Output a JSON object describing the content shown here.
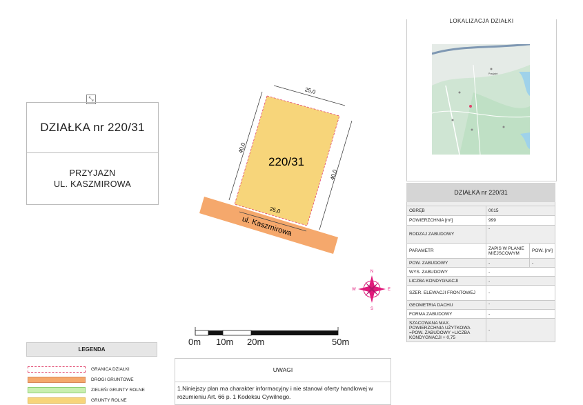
{
  "title": {
    "plot_name": "DZIAŁKA nr 220/31",
    "location_line1": "PRZYJAZN",
    "location_line2": "UL. KASZMIROWA"
  },
  "plan": {
    "plot_label": "220/31",
    "dim_top": "25,0",
    "dim_bottom": "25,0",
    "dim_left": "40,0",
    "dim_right": "40,0",
    "street": "ul. Kaszmirowa",
    "colors": {
      "plot_fill": "#f7d57a",
      "road_fill": "#f5a86c",
      "boundary": "#e0436b"
    }
  },
  "compass": {
    "n": "N",
    "s": "S",
    "e": "E",
    "w": "W",
    "color": "#e0197a"
  },
  "scale": {
    "labels": [
      "0m",
      "10m",
      "20m",
      "50m"
    ]
  },
  "map": {
    "title": "LOKALIZACJA DZIAŁKI",
    "place_label": "Przyjaźń"
  },
  "info": {
    "header": "DZIAŁKA nr 220/31",
    "rows": [
      {
        "label": "OBRĘB",
        "value": "0015"
      },
      {
        "label": "POWIERZCHNIA [m²]",
        "value": "999"
      },
      {
        "label": "RODZAJ ZABUDOWY",
        "value": "-"
      }
    ],
    "param_label": "PARAMETR",
    "param_col1": "ZAPIS W PLANIE MIEJSCOWYM",
    "param_col2": "POW. [m²]",
    "param_rows": [
      {
        "label": "POW. ZABUDOWY",
        "value": "-",
        "value2": "-"
      },
      {
        "label": "WYS. ZABUDOWY",
        "value": "-"
      },
      {
        "label": "LICZBA KONDYGNACJI",
        "value": "-"
      },
      {
        "label": "SZER. ELEWACJI FRONTOWEJ",
        "value": "-"
      },
      {
        "label": "GEOMETRIA DACHU",
        "value": "-"
      },
      {
        "label": "FORMA ZABUDOWY",
        "value": "-"
      },
      {
        "label": "SZACOWANA MAX. POWIERZCHNIA UŻYTKOWA =POW. ZABUDOWY +LICZBA KONDYGNACJI + 0,75",
        "value": "-"
      }
    ]
  },
  "legend": {
    "title": "LEGENDA",
    "items": [
      {
        "label": "GRANICA DZIAŁKI",
        "color": "#e0436b",
        "style": "dashed"
      },
      {
        "label": "DROGI GRUNTOWE",
        "color": "#f5a86c",
        "style": "fill"
      },
      {
        "label": "ZIELEŃ/ GRUNTY ROLNE",
        "color": "#c9efb0",
        "style": "fill"
      },
      {
        "label": "GRUNTY ROLNE",
        "color": "#f7d57a",
        "style": "fill"
      }
    ]
  },
  "notes": {
    "title": "UWAGI",
    "text": "1.Niniejszy plan ma charakter informacyjny i nie stanowi oferty handlowej w rozumieniu Art. 66 p. 1 Kodeksu Cywilnego."
  }
}
